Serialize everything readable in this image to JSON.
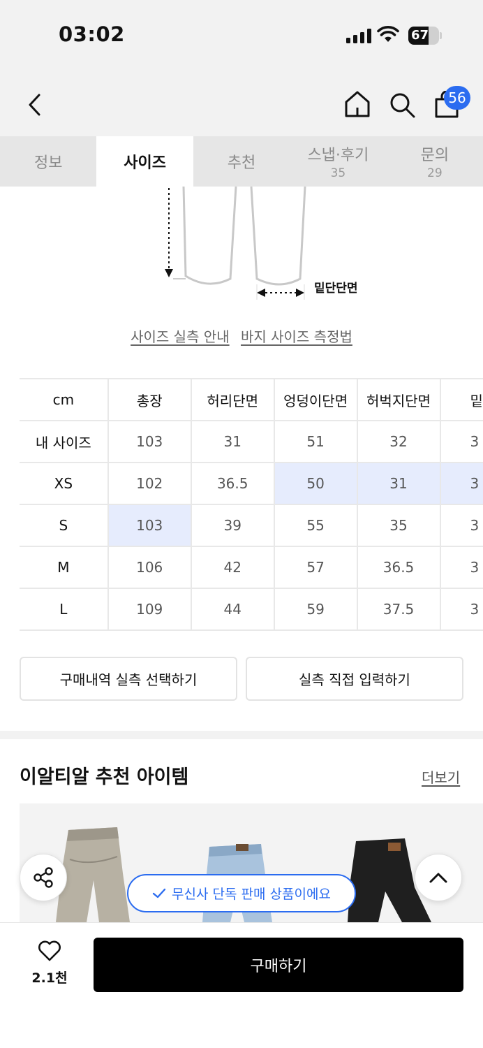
{
  "status_bar": {
    "time": "03:02",
    "battery": "67",
    "battery_level": 0.67
  },
  "header": {
    "cart_count": "56"
  },
  "tabs": [
    {
      "label": "정보",
      "count": ""
    },
    {
      "label": "사이즈",
      "count": ""
    },
    {
      "label": "추천",
      "count": ""
    },
    {
      "label": "스냅·후기",
      "count": "35"
    },
    {
      "label": "문의",
      "count": "29"
    }
  ],
  "active_tab": "사이즈",
  "diagram": {
    "hem_label": "밑단단면"
  },
  "guide_links": {
    "actual_size_guide": "사이즈 실측 안내",
    "pants_measure_guide": "바지 사이즈 측정법"
  },
  "size_table": {
    "unit_header": "cm",
    "columns": [
      "총장",
      "허리단면",
      "엉덩이단면",
      "허벅지단면",
      "밑"
    ],
    "rows": [
      {
        "label": "내 사이즈",
        "values": [
          "103",
          "31",
          "51",
          "32",
          "3"
        ]
      },
      {
        "label": "XS",
        "values": [
          "102",
          "36.5",
          "50",
          "31",
          "3"
        ]
      },
      {
        "label": "S",
        "values": [
          "103",
          "39",
          "55",
          "35",
          "3"
        ]
      },
      {
        "label": "M",
        "values": [
          "106",
          "42",
          "57",
          "36.5",
          "3"
        ]
      },
      {
        "label": "L",
        "values": [
          "109",
          "44",
          "59",
          "37.5",
          "3"
        ]
      }
    ]
  },
  "actions": {
    "select_purchase_history": "구매내역 실측 선택하기",
    "manual_input": "실측 직접 입력하기"
  },
  "recommend": {
    "title": "이알티알 추천 아이템",
    "more": "더보기"
  },
  "exclusive_badge": "무신사 단독 판매 상품이에요",
  "bottom_bar": {
    "like_count": "2.1천",
    "buy_label": "구매하기"
  },
  "colors": {
    "accent_blue": "#2b6cf0",
    "highlight_cell": "#e6ecfd",
    "buy_button": "#000000"
  }
}
